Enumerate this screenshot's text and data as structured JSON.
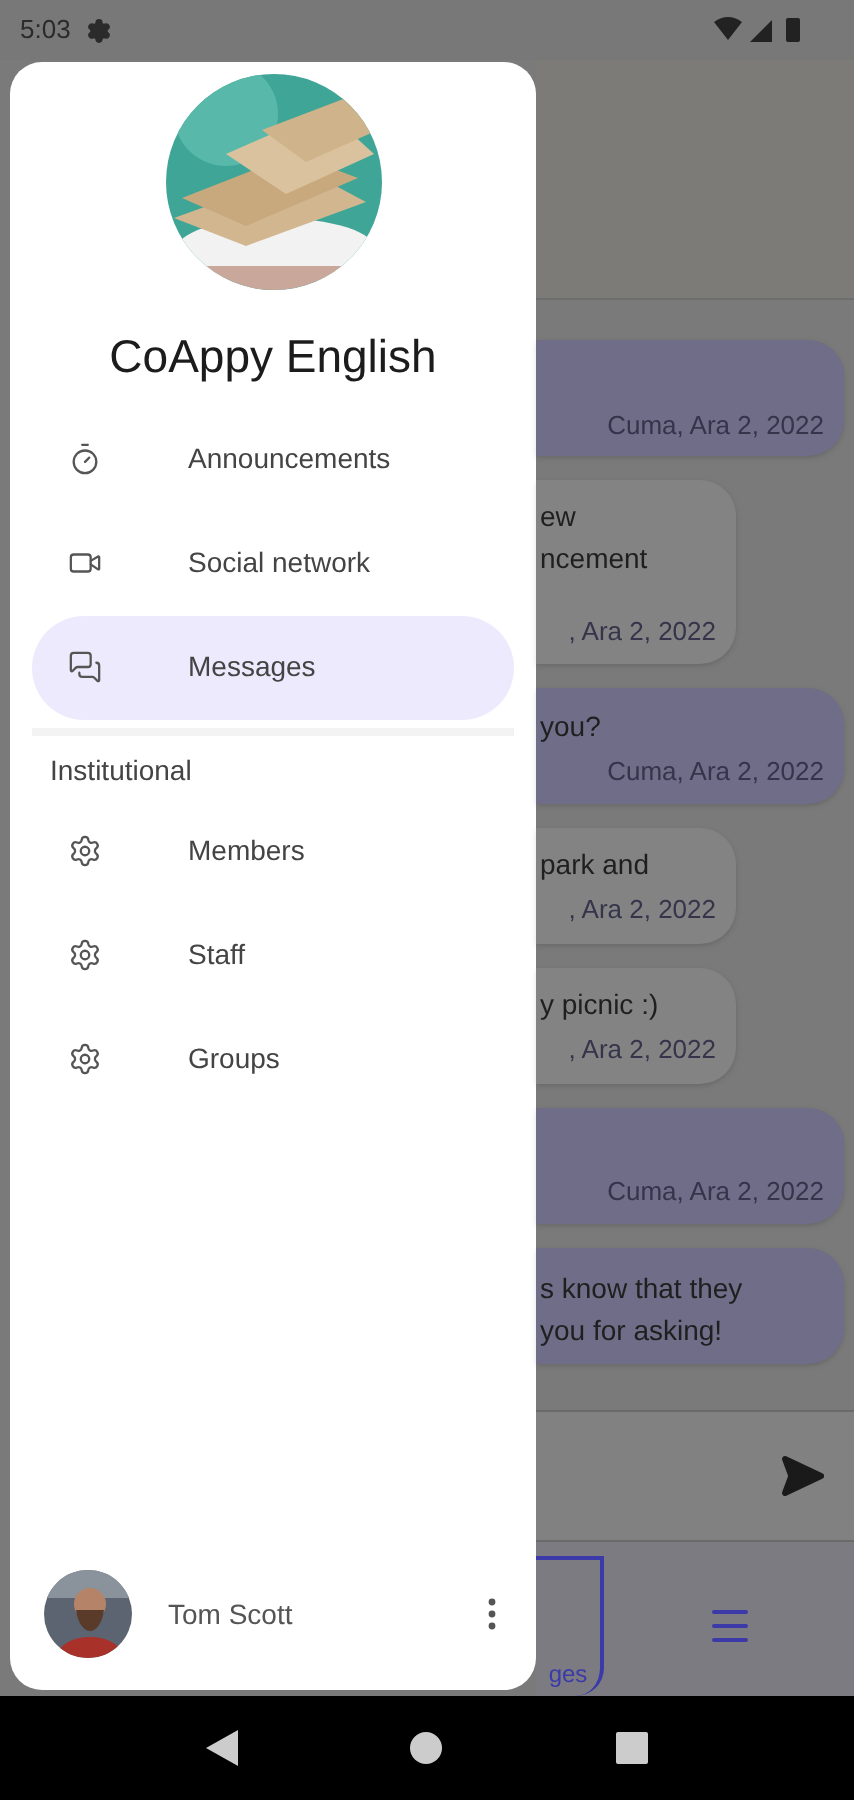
{
  "status_bar": {
    "time": "5:03"
  },
  "drawer": {
    "title": "CoAppy English",
    "items": [
      {
        "label": "Announcements",
        "kind": "timer",
        "selected": false
      },
      {
        "label": "Social network",
        "kind": "video",
        "selected": false
      },
      {
        "label": "Messages",
        "kind": "messages",
        "selected": true
      }
    ],
    "section": {
      "title": "Institutional",
      "items": [
        {
          "label": "Members",
          "kind": "gear",
          "selected": false
        },
        {
          "label": "Staff",
          "kind": "gear",
          "selected": false
        },
        {
          "label": "Groups",
          "kind": "gear",
          "selected": false
        }
      ]
    },
    "user": {
      "name": "Tom Scott"
    }
  },
  "chat": {
    "messages": [
      {
        "kind": "sent",
        "date": "Cuma, Ara 2, 2022"
      },
      {
        "kind": "received",
        "lines": [
          "ew",
          "ncement"
        ],
        "date": ", Ara 2, 2022"
      },
      {
        "kind": "sent",
        "lines": [
          "you?"
        ],
        "date": "Cuma, Ara 2, 2022"
      },
      {
        "kind": "received",
        "lines": [
          "park and"
        ],
        "date": ", Ara 2, 2022"
      },
      {
        "kind": "received",
        "lines": [
          "y picnic :)"
        ],
        "date": ", Ara 2, 2022"
      },
      {
        "kind": "sent",
        "date": "Cuma, Ara 2, 2022"
      },
      {
        "kind": "sent",
        "lines": [
          "s know that they",
          "you for asking!"
        ]
      }
    ],
    "tabs": [
      {
        "label": "ges",
        "kind": "label",
        "selected": true
      },
      {
        "kind": "menu",
        "selected": false
      }
    ]
  }
}
